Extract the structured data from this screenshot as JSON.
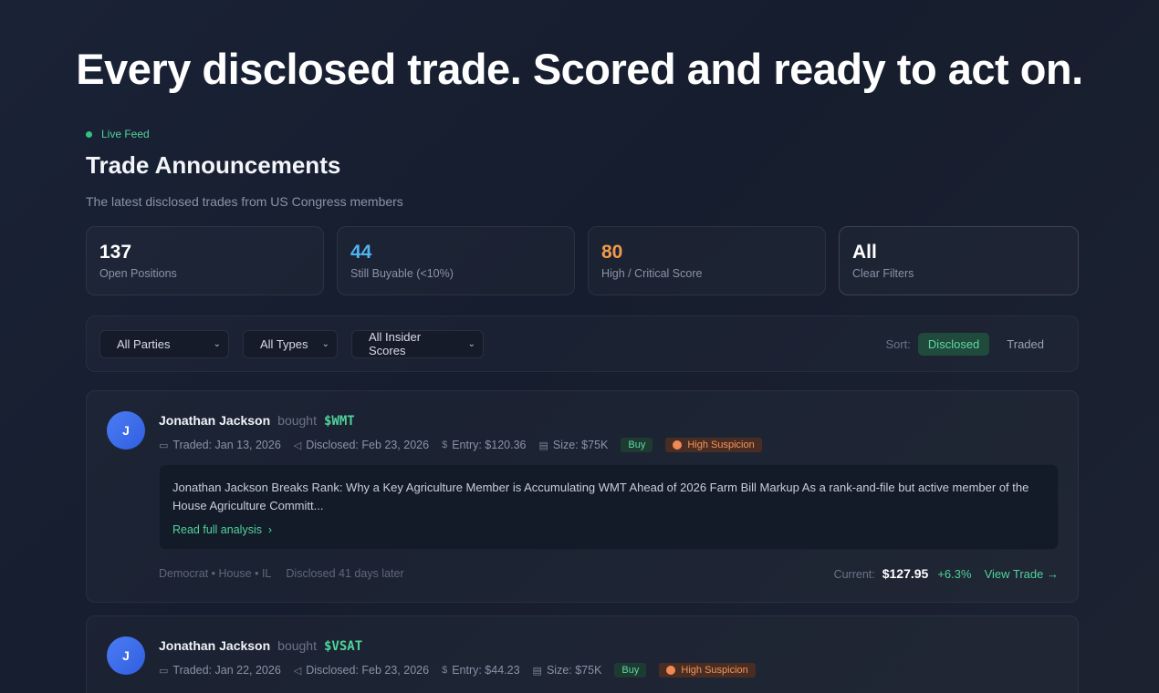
{
  "headline": "Every disclosed trade. Scored and ready to act on.",
  "feed": {
    "live_label": "Live Feed",
    "title": "Trade Announcements",
    "subtitle": "The latest disclosed trades from US Congress members"
  },
  "stats": [
    {
      "value": "137",
      "label": "Open Positions",
      "color": "#ffffff"
    },
    {
      "value": "44",
      "label": "Still Buyable (<10%)",
      "color": "#4fb3f0"
    },
    {
      "value": "80",
      "label": "High / Critical Score",
      "color": "#f29a4a"
    },
    {
      "value": "All",
      "label": "Clear Filters",
      "color": "#ffffff"
    }
  ],
  "filters": {
    "parties": "All Parties",
    "types": "All Types",
    "scores": "All Insider Scores",
    "sort_label": "Sort:",
    "sort_disclosed": "Disclosed",
    "sort_traded": "Traded"
  },
  "trades": [
    {
      "initial": "J",
      "name": "Jonathan Jackson",
      "verb": "bought",
      "ticker": "$WMT",
      "traded": "Traded: Jan 13, 2026",
      "disclosed": "Disclosed: Feb 23, 2026",
      "entry": "Entry: $120.36",
      "size": "Size: $75K",
      "type": "Buy",
      "suspicion": "High Suspicion",
      "analysis": "Jonathan Jackson Breaks Rank: Why a Key Agriculture Member is Accumulating WMT Ahead of 2026 Farm Bill Markup As a rank-and-file but active member of the House Agriculture Committ...",
      "read_more": "Read full analysis",
      "affiliation": "Democrat • House • IL",
      "delay": "Disclosed 41 days later",
      "current_label": "Current:",
      "current_price": "$127.95",
      "change": "+6.3%",
      "view": "View Trade →"
    },
    {
      "initial": "J",
      "name": "Jonathan Jackson",
      "verb": "bought",
      "ticker": "$VSAT",
      "traded": "Traded: Jan 22, 2026",
      "disclosed": "Disclosed: Feb 23, 2026",
      "entry": "Entry: $44.23",
      "size": "Size: $75K",
      "type": "Buy",
      "suspicion": "High Suspicion"
    }
  ]
}
